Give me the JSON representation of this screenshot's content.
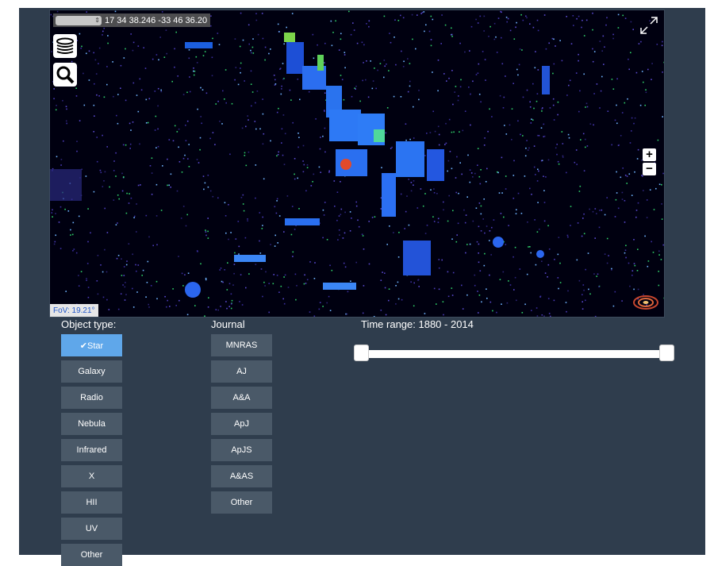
{
  "sky_viewer": {
    "frame_select": "",
    "coordinates": "17 34 38.246 -33 46 36.20",
    "fov": "FoV: 19.21°",
    "layers_icon": "layers-icon",
    "search_icon": "search-icon",
    "zoom_in_label": "+",
    "zoom_out_label": "−"
  },
  "filters": {
    "object_type": {
      "label": "Object type:",
      "items": [
        "✔Star",
        "Galaxy",
        "Radio",
        "Nebula",
        "Infrared",
        "X",
        "HII",
        "UV",
        "Other"
      ],
      "active": "Star"
    },
    "journal": {
      "label": "Journal",
      "items": [
        "MNRAS",
        "AJ",
        "A&A",
        "ApJ",
        "ApJS",
        "A&AS",
        "Other"
      ]
    },
    "time_range": {
      "label": "Time range: 1880 - 2014",
      "min": 1880,
      "max": 2014
    }
  },
  "colors": {
    "panel": "#2f3d4d",
    "button": "#4a5968",
    "button_active": "#5fa7ea"
  }
}
